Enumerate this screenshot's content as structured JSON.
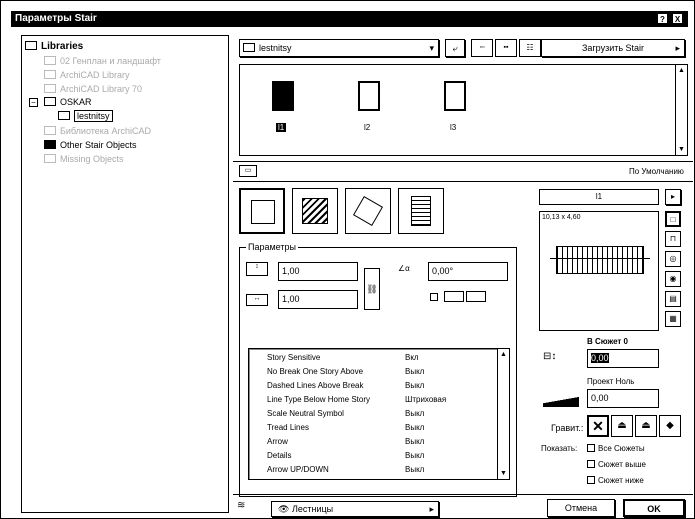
{
  "window": {
    "title": "Параметры Stair",
    "help_button": "?",
    "close_button": "X"
  },
  "tree": {
    "items": [
      {
        "label": "Libraries",
        "level": 0,
        "dim": false,
        "expanded": true
      },
      {
        "label": "02 Генплан и ландшафт",
        "level": 1,
        "dim": true
      },
      {
        "label": "ArchiCAD Library",
        "level": 1,
        "dim": true
      },
      {
        "label": "ArchiCAD Library 70",
        "level": 1,
        "dim": true
      },
      {
        "label": "OSKAR",
        "level": 1,
        "dim": false,
        "toggle": "−"
      },
      {
        "label": "lestnitsy",
        "level": 2,
        "dim": false,
        "selected": true
      },
      {
        "label": "Библиотека ArchiCAD",
        "level": 1,
        "dim": true
      },
      {
        "label": "Other Stair Objects",
        "level": 1,
        "dim": false,
        "filled": true
      },
      {
        "label": "Missing Objects",
        "level": 1,
        "dim": true
      }
    ]
  },
  "folder_select": {
    "value": "lestnitsy"
  },
  "load_button": {
    "label": "Загрузить Stair"
  },
  "objects": [
    {
      "label": "l1",
      "selected": true
    },
    {
      "label": "l2"
    },
    {
      "label": "l3"
    }
  ],
  "default_label": "По Умолчанию",
  "params": {
    "group_label": "Параметры",
    "height_value": "1,00",
    "width_value": "1,00",
    "angle_value": "0,00°",
    "list": [
      {
        "name": "Story Sensitive",
        "value": "Вкл"
      },
      {
        "name": "No Break One Story Above",
        "value": "Выкл"
      },
      {
        "name": "Dashed Lines Above Break",
        "value": "Выкл"
      },
      {
        "name": "Line Type Below Home Story",
        "value": "Штриховая"
      },
      {
        "name": "Scale Neutral Symbol",
        "value": "Выкл"
      },
      {
        "name": "Tread Lines",
        "value": "Выкл"
      },
      {
        "name": "Arrow",
        "value": "Выкл"
      },
      {
        "name": "Details",
        "value": "Выкл"
      },
      {
        "name": "Arrow UP/DOWN",
        "value": "Выкл"
      }
    ]
  },
  "preview": {
    "name": "l1",
    "size_text": "10,13 x 4,60"
  },
  "story": {
    "label": "В Сюжет 0",
    "value": "0,00",
    "projection_label": "Проект Ноль",
    "projection_value": "0,00",
    "gravity_label": "Гравит.:",
    "show_label": "Показать:",
    "show_options": [
      "Все Сюжеты",
      "Сюжет выше",
      "Сюжет ниже"
    ]
  },
  "layer_select": {
    "value": "Лестницы"
  },
  "cancel_button": {
    "label": "Отмена"
  },
  "ok_button": {
    "label": "OK"
  }
}
